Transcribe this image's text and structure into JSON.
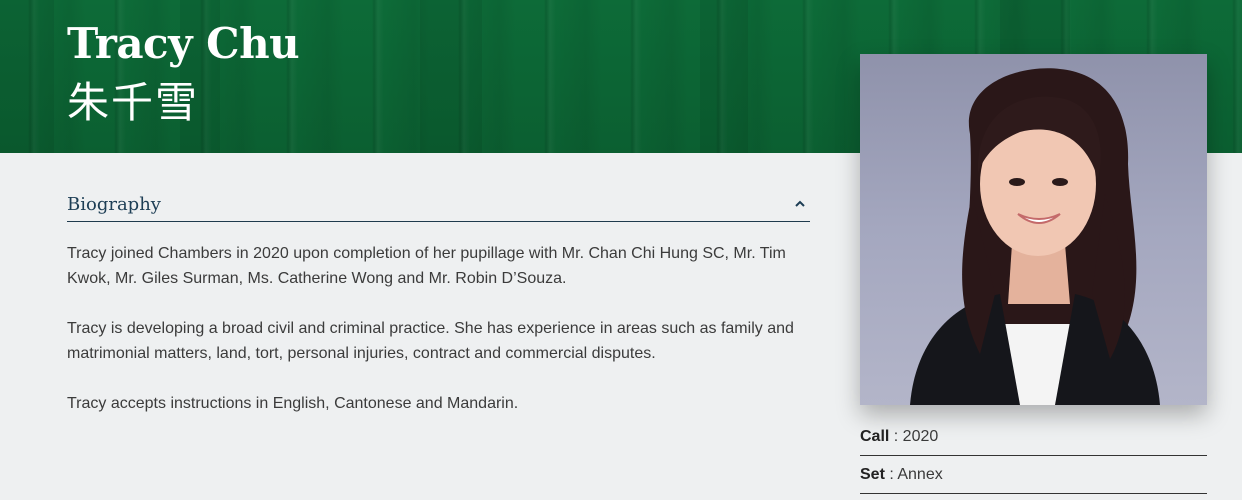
{
  "profile": {
    "name_en": "Tracy Chu",
    "name_zh": "朱千雪"
  },
  "biography": {
    "title": "Biography",
    "toggle_icon": "chevron-up-icon",
    "paragraphs": [
      "Tracy joined Chambers in 2020 upon completion of her pupillage with Mr. Chan Chi Hung SC, Mr. Tim Kwok, Mr. Giles Surman, Ms. Catherine Wong and Mr. Robin D’Souza.",
      "Tracy is developing a broad civil and criminal practice. She has experience in areas such as family and matrimonial matters, land, tort, personal injuries, contract and commercial disputes.",
      "Tracy accepts instructions in English, Cantonese and Mandarin."
    ]
  },
  "details": {
    "call_label": "Call",
    "call_value": " : 2020",
    "set_label": "Set",
    "set_value": " : Annex"
  },
  "colors": {
    "hero_green": "#0b5f31",
    "heading_navy": "#1d3e55",
    "page_bg": "#eef0f1"
  }
}
